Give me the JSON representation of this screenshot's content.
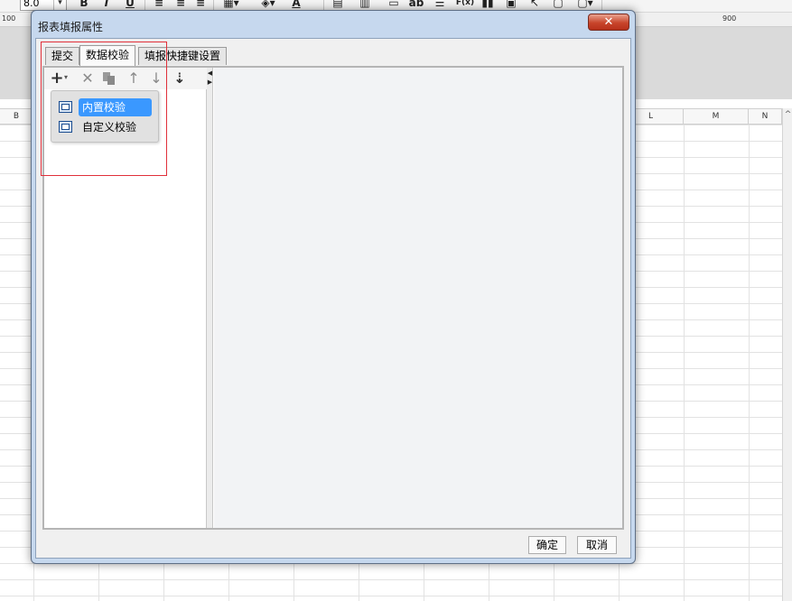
{
  "app": {
    "font_size": "8.0",
    "toolbar_bold": "B",
    "toolbar_italic": "I",
    "toolbar_underline": "U",
    "toolbar_text_ab": "ab",
    "toolbar_formula": "F(x)",
    "toolbar_font_color": "A",
    "ruler_labels": [
      "100",
      "900"
    ],
    "col_headers": [
      "B",
      "L",
      "M",
      "N"
    ]
  },
  "dialog": {
    "title": "报表填报属性",
    "close_label": "✕",
    "tabs": [
      {
        "label": "提交"
      },
      {
        "label": "数据校验"
      },
      {
        "label": "填报快捷键设置"
      }
    ],
    "toolbar": {
      "add_icon": "+",
      "add_caret": "▾",
      "delete_icon": "✕",
      "up_icon": "↑",
      "down_icon": "↓",
      "sort_icon": "⇣"
    },
    "menu": {
      "items": [
        {
          "label": "内置校验"
        },
        {
          "label": "自定义校验"
        }
      ]
    },
    "ok_label": "确定",
    "cancel_label": "取消"
  },
  "colors": {
    "selection": "#3a98ff",
    "close_button": "#c8452b",
    "highlight_box": "#e0303a",
    "dialog_frame": "#c6d8ee"
  }
}
